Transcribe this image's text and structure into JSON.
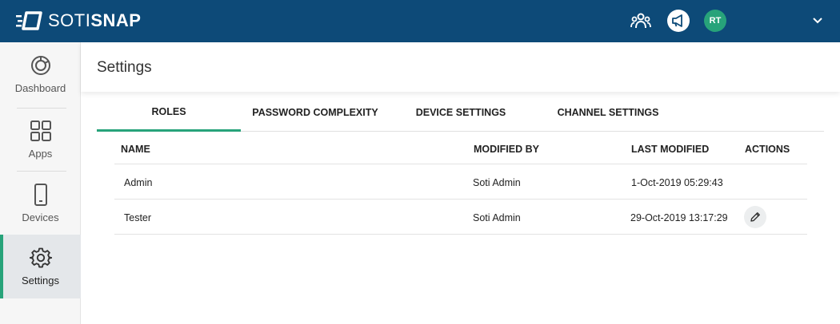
{
  "brand": {
    "name_part1": "SOTI",
    "name_part2": "SNAP"
  },
  "topbar": {
    "icons": [
      "community-icon",
      "announcement-icon",
      "chevron-down-icon"
    ],
    "avatar_initials": "RT",
    "colors": {
      "bar": "#0d4a78",
      "avatar": "#27a37a"
    }
  },
  "sidebar": {
    "items": [
      {
        "label": "Dashboard",
        "icon": "dashboard-icon",
        "active": false
      },
      {
        "label": "Apps",
        "icon": "apps-grid-icon",
        "active": false
      },
      {
        "label": "Devices",
        "icon": "mobile-device-icon",
        "active": false
      },
      {
        "label": "Settings",
        "icon": "gear-icon",
        "active": true
      }
    ]
  },
  "header": {
    "title": "Settings"
  },
  "tabs": [
    {
      "label": "ROLES",
      "active": true
    },
    {
      "label": "PASSWORD COMPLEXITY",
      "active": false
    },
    {
      "label": "DEVICE SETTINGS",
      "active": false
    },
    {
      "label": "CHANNEL SETTINGS",
      "active": false
    }
  ],
  "table": {
    "columns": [
      "NAME",
      "MODIFIED BY",
      "LAST MODIFIED",
      "ACTIONS"
    ],
    "rows": [
      {
        "name": "Admin",
        "modified_by": "Soti Admin",
        "last_modified": "1-Oct-2019 05:29:43",
        "actions": []
      },
      {
        "name": "Tester",
        "modified_by": "Soti Admin",
        "last_modified": "29-Oct-2019 13:17:29",
        "actions": [
          "edit-icon"
        ]
      }
    ]
  },
  "accent_color": "#27a37a"
}
